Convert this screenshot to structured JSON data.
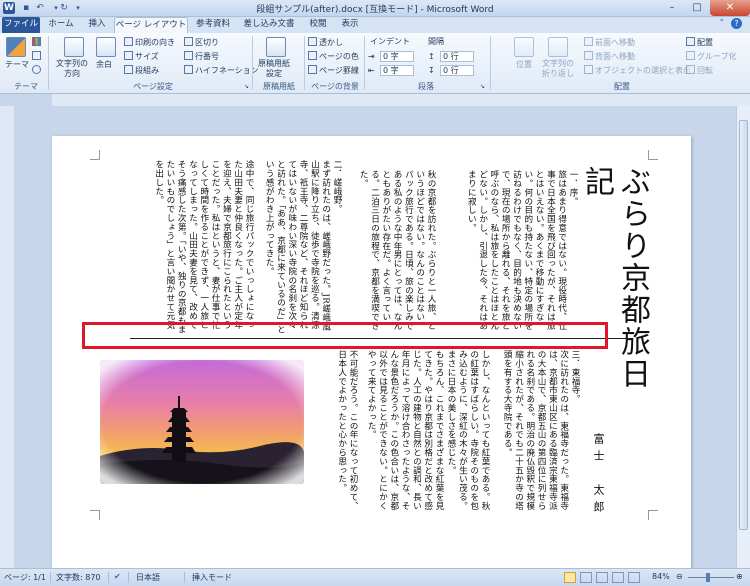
{
  "window": {
    "title": "段組サンプル(after).docx [互換モード] - Microsoft Word",
    "minimize": "–",
    "maximize": "□",
    "close": "✕"
  },
  "tabs": [
    "ファイル",
    "ホーム",
    "挿入",
    "ページ レイアウト",
    "参考資料",
    "差し込み文書",
    "校閲",
    "表示"
  ],
  "ribbon": {
    "theme": {
      "theme_label": "テーマ",
      "group": "テーマ"
    },
    "page_setup": {
      "text_direction": "文字列の\n方向",
      "margins": "余白",
      "orientation": "印刷の向き",
      "size": "サイズ",
      "columns": "段組み",
      "breaks": "区切り",
      "line_numbers": "行番号",
      "hyphenation": "ハイフネーション",
      "group": "ページ設定"
    },
    "manuscript": {
      "button": "原稿用紙\n設定",
      "group": "原稿用紙"
    },
    "background": {
      "watermark": "透かし",
      "page_color": "ページの色",
      "page_borders": "ページ罫線",
      "group": "ページの背景"
    },
    "paragraph": {
      "indent_label": "インデント",
      "spacing_label": "間隔",
      "indent_left": "0 字",
      "indent_right": "0 字",
      "spacing_before": "0 行",
      "spacing_after": "0 行",
      "group": "段落"
    },
    "arrange": {
      "position": "位置",
      "wrap": "文字列の\n折り返し",
      "bring_forward": "前面へ移動",
      "send_backward": "背面へ移動",
      "selection_pane": "オブジェクトの選択と表示",
      "align": "配置",
      "group_btn": "グループ化",
      "rotate": "回転",
      "group": "配置"
    }
  },
  "document": {
    "title": "ぶらり京都旅日記",
    "author": "富士　太郎",
    "columns": [
      {
        "text": "一．序。\n旅はあまり得意ではない。現役時代、仕事で日本全国を飛び回ったが、それは旅とはいえない。あくまで移動にすぎない。何の目的も持たない、特定の場所を訪ねるわけでもなく、目的地も決めないで、現在の場所から離れる、それを旅と呼ぶのなら、私は旅をしたことはほとんどない。しかし、引退した今、それはあまりに寂しい。"
      },
      {
        "text": "秋の京都を訪れた。ぶらりと一人旅、というほどではない。なんのことはない、パック旅行である。日頃、旅の楽しみである私のような中年男にとっては、なんともありがたい存在だ。よく言っている。二泊三日の旅程で、京都を満喫できた。"
      },
      {
        "text": "二．嵯峨野。\nまず訪れたのは、嵯峨野だった。JR嵯峨嵐山駅に降り立ち、徒歩で寺院を巡る。清涼寺、祇王寺、二尊院など、それほど知られてはいないが味わい深い寺院の名刹を次々と訪れた。「ああ、京都に来ているのだ」という感がわき上がってきた。"
      },
      {
        "text": "途中で、同じ旅行パックでいっしょになった山田夫妻と仲良くなった。ご主人が定年を迎え、夫婦で京都旅行にこられたということだった。私はというと、妻が仕事で忙しくて時間を作ることができず、一人旅となってしまった。山田夫妻を見て、改めてそう痛感した次第。「いや、独りの京都もまたいいものでしょう」と言い聞かせて元気を出した。"
      },
      {
        "text": "三．東福寺。\n次に訪れたのは、東福寺だった。東福寺は、京都市東山区にある臨済宗東福寺派の大本山で、京都五山の第四位に列せられる名刹である。明治の廃仏毀釈で規模縮小されたが、それでも二十五か寺の塔頭を有する大寺院である。"
      },
      {
        "text": "しかし、なんといっても紅葉である。秋の紅葉はすばらしい。寺院そのものを包み込むように、深紅の木々が生い茂る。まさに日本の美しさを感じた。"
      },
      {
        "text": "もちろん、これまでさまざまな紅葉を見てきた。やはり京都は別格だと改めて感じた。人工の建物と自然との調和、長い年月によって溶け合わさったような、そんな景色だろうか。この色合いは、京都以外では見ることができない。とにかくやって来てよかった。"
      },
      {
        "text": "不可能だろう。この年になって初めて、日本人でよかったと心から思った。"
      }
    ]
  },
  "statusbar": {
    "page": "ページ: 1/1",
    "words": "文字数: 870",
    "language": "日本語",
    "mode": "挿入モード",
    "zoom": "84%"
  }
}
